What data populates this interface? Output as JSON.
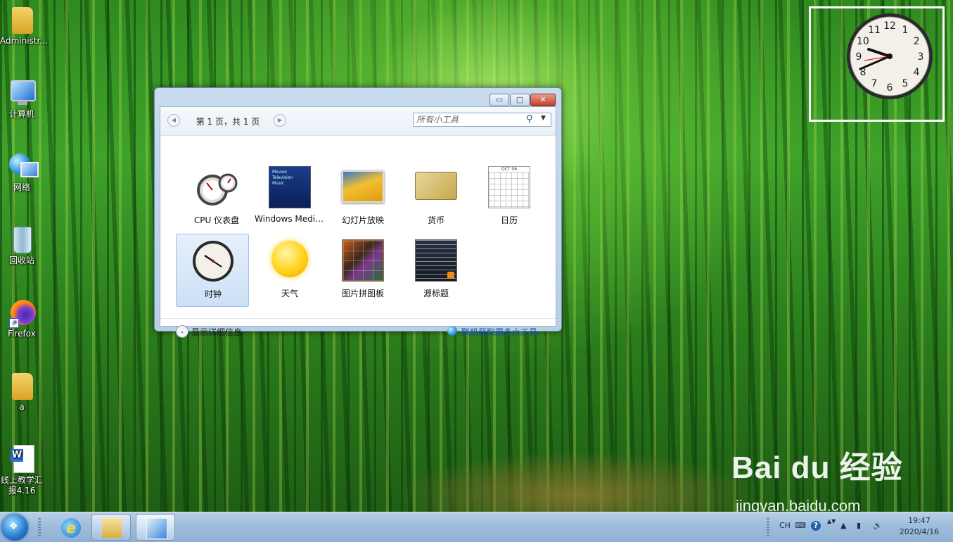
{
  "desktop": {
    "icons": [
      {
        "label": "Administr...",
        "icon": "user-folder-icon"
      },
      {
        "label": "计算机",
        "icon": "computer-icon"
      },
      {
        "label": "网络",
        "icon": "network-icon"
      },
      {
        "label": "回收站",
        "icon": "recycle-bin-icon"
      },
      {
        "label": "Firefox",
        "icon": "firefox-icon"
      },
      {
        "label": "a",
        "icon": "folder-icon"
      },
      {
        "label": "线上教学汇报4.16",
        "icon": "word-document-icon"
      }
    ]
  },
  "gadget_window": {
    "window_buttons": {
      "minimize": "▭",
      "maximize": "▢",
      "close": "✕"
    },
    "pager": {
      "text": "第 1 页，共 1 页",
      "prev": "◀",
      "next": "▶"
    },
    "search": {
      "placeholder": "所有小工具",
      "icon": "search-icon",
      "dropdown": "▼"
    },
    "gadgets": [
      {
        "label": "CPU 仪表盘",
        "icon": "cpu-meter-icon",
        "selected": false
      },
      {
        "label": "Windows Media Center",
        "icon": "media-center-icon",
        "selected": false
      },
      {
        "label": "幻灯片放映",
        "icon": "slideshow-icon",
        "selected": false
      },
      {
        "label": "货币",
        "icon": "currency-icon",
        "selected": false
      },
      {
        "label": "日历",
        "icon": "calendar-icon",
        "selected": false
      },
      {
        "label": "时钟",
        "icon": "clock-icon",
        "selected": true
      },
      {
        "label": "天气",
        "icon": "weather-icon",
        "selected": false
      },
      {
        "label": "图片拼图板",
        "icon": "picture-puzzle-icon",
        "selected": false
      },
      {
        "label": "源标题",
        "icon": "feed-headlines-icon",
        "selected": false
      }
    ],
    "media_center_lines": [
      "Movies",
      "Television",
      "Music"
    ],
    "calendar_month": "OCT 06",
    "footer": {
      "details_label": "显示详细信息",
      "details_icon": "⌄",
      "online_label": "联机获取更多小工具"
    }
  },
  "clock_gadget": {
    "numbers": [
      "12",
      "1",
      "2",
      "3",
      "4",
      "5",
      "6",
      "7",
      "8",
      "9",
      "10",
      "11"
    ]
  },
  "taskbar": {
    "start_icon": "windows-start-icon",
    "ie_letter": "e",
    "tray": {
      "language": "CH",
      "keyboard": "⌨",
      "help": "?",
      "arrows": "▲▼",
      "show_hidden": "▲",
      "network": "▮",
      "volume": "🔊"
    },
    "time": "19:47",
    "date": "2020/4/16"
  },
  "watermark": {
    "logo_text": "Bai du 经验",
    "url": "jingyan.baidu.com"
  },
  "colors": {
    "link": "#1a56b5",
    "selection": "#cde0f5",
    "close_button": "#c3402a"
  }
}
